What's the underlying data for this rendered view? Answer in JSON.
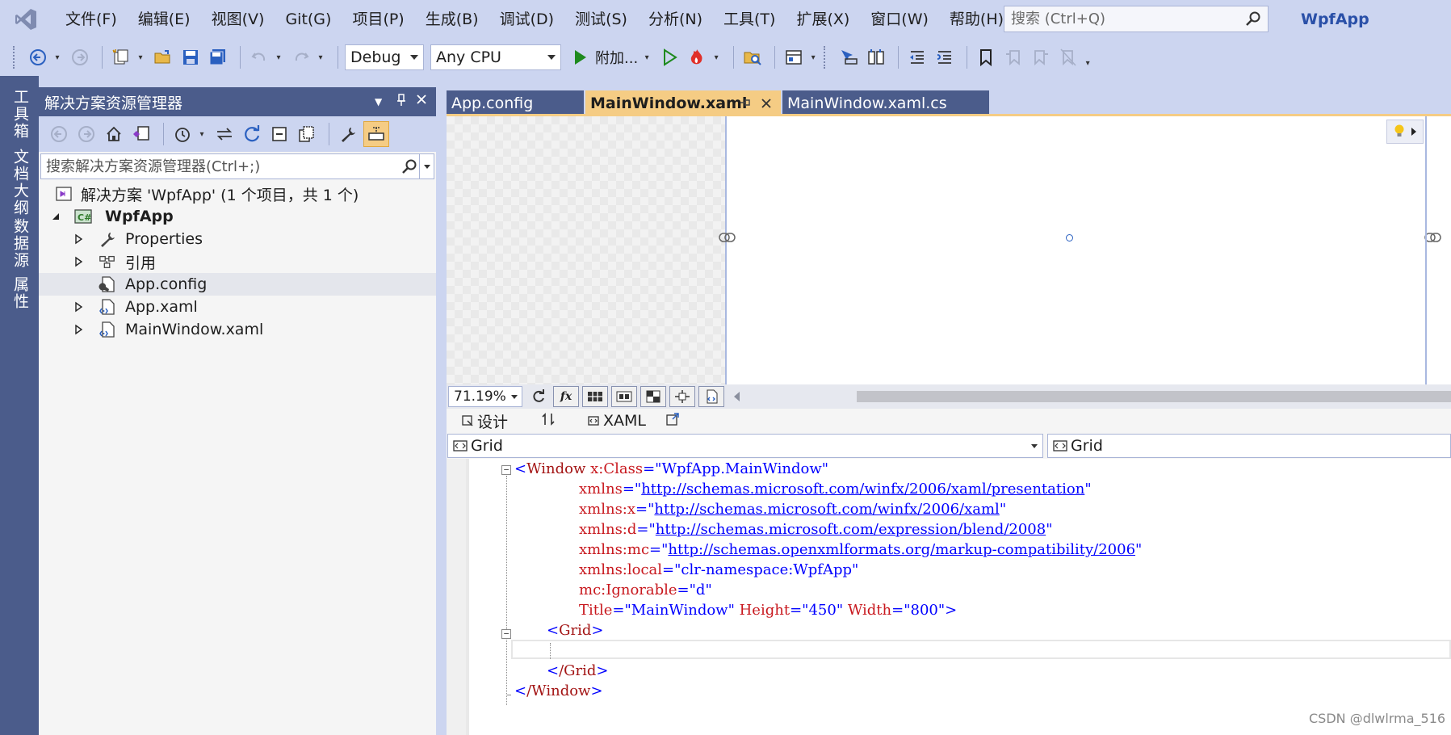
{
  "menu": {
    "items": [
      "文件(F)",
      "编辑(E)",
      "视图(V)",
      "Git(G)",
      "项目(P)",
      "生成(B)",
      "调试(D)",
      "测试(S)",
      "分析(N)",
      "工具(T)",
      "扩展(X)",
      "窗口(W)",
      "帮助(H)"
    ],
    "search_placeholder": "搜索 (Ctrl+Q)",
    "app_title": "WpfApp"
  },
  "toolbar": {
    "config": "Debug",
    "platform": "Any CPU",
    "attach_label": "附加..."
  },
  "left_strip": {
    "tabs": [
      "工具箱",
      "文档大纲",
      "数据源",
      "属性"
    ]
  },
  "solution_explorer": {
    "title": "解决方案资源管理器",
    "search_placeholder": "搜索解决方案资源管理器(Ctrl+;)",
    "tree": {
      "solution": "解决方案 'WpfApp' (1 个项目，共 1 个)",
      "project": "WpfApp",
      "items": [
        "Properties",
        "引用",
        "App.config",
        "App.xaml",
        "MainWindow.xaml"
      ]
    }
  },
  "editor": {
    "tabs": [
      "App.config",
      "MainWindow.xaml",
      "MainWindow.xaml.cs"
    ],
    "zoom": "71.19%",
    "design_label": "设计",
    "xaml_label": "XAML",
    "left_nav": "Grid",
    "right_nav": "Grid",
    "code": {
      "window_open": "Window",
      "class_attr": "x:Class",
      "class_val": "WpfApp.MainWindow",
      "xmlns_attr": "xmlns",
      "xmlns_val": "http://schemas.microsoft.com/winfx/2006/xaml/presentation",
      "xmlns_x_attr": "xmlns:x",
      "xmlns_x_val": "http://schemas.microsoft.com/winfx/2006/xaml",
      "xmlns_d_attr": "xmlns:d",
      "xmlns_d_val": "http://schemas.microsoft.com/expression/blend/2008",
      "xmlns_mc_attr": "xmlns:mc",
      "xmlns_mc_val": "http://schemas.openxmlformats.org/markup-compatibility/2006",
      "xmlns_local_attr": "xmlns:local",
      "xmlns_local_val": "clr-namespace:WpfApp",
      "ignorable_attr": "mc:Ignorable",
      "ignorable_val": "d",
      "title_attr": "Title",
      "title_val": "MainWindow",
      "height_attr": "Height",
      "height_val": "450",
      "width_attr": "Width",
      "width_val": "800",
      "grid_tag": "Grid",
      "grid_close": "/Grid",
      "window_close": "/Window"
    }
  },
  "watermark": "CSDN @dlwlrma_516",
  "colors": {
    "chrome": "#ccd5f0",
    "panel_header": "#4b5c8b",
    "active_tab": "#f5cc84",
    "play_green": "#1e8a1e",
    "xaml_tag": "#a31515",
    "xaml_value": "#0000ff"
  }
}
